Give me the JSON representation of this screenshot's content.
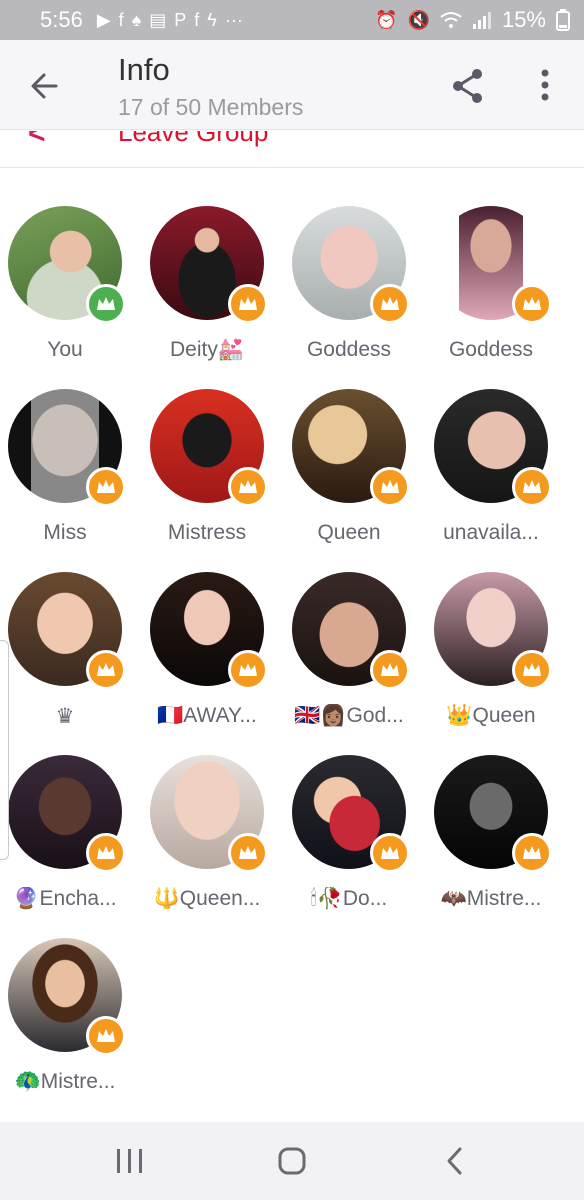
{
  "status_bar": {
    "time": "5:56",
    "left_icons": [
      "▶",
      "f",
      "♠",
      "▤",
      "P",
      "f",
      "ϟ",
      "···"
    ],
    "right_icons": [
      "⏰",
      "🔇",
      "wifi",
      "signal"
    ],
    "battery": "15%"
  },
  "header": {
    "title": "Info",
    "subtitle": "17 of 50 Members"
  },
  "leave_group": {
    "label": "Leave Group"
  },
  "colors": {
    "accent_orange": "#f49a1e",
    "online_green": "#4caf50",
    "leave_red": "#e0102a"
  },
  "members": [
    {
      "name": "You",
      "badge": "online"
    },
    {
      "name": "Deity💒",
      "badge": "crown"
    },
    {
      "name": "Goddess",
      "badge": "crown"
    },
    {
      "name": "Goddess",
      "badge": "crown"
    },
    {
      "name": "Miss",
      "badge": "crown"
    },
    {
      "name": "Mistress",
      "badge": "crown"
    },
    {
      "name": "Queen",
      "badge": "crown"
    },
    {
      "name": "unavaila...",
      "badge": "crown"
    },
    {
      "name": "♛",
      "badge": "crown"
    },
    {
      "name": "🇫🇷AWAY...",
      "badge": "crown"
    },
    {
      "name": "🇬🇧👩🏽God...",
      "badge": "crown"
    },
    {
      "name": "👑Queen",
      "badge": "crown"
    },
    {
      "name": "🔮Encha...",
      "badge": "crown"
    },
    {
      "name": "🔱Queen...",
      "badge": "crown"
    },
    {
      "name": "🕯🥀Do...",
      "badge": "crown"
    },
    {
      "name": "🦇Mistre...",
      "badge": "crown"
    },
    {
      "name": "🦚Mistre...",
      "badge": "crown"
    }
  ]
}
